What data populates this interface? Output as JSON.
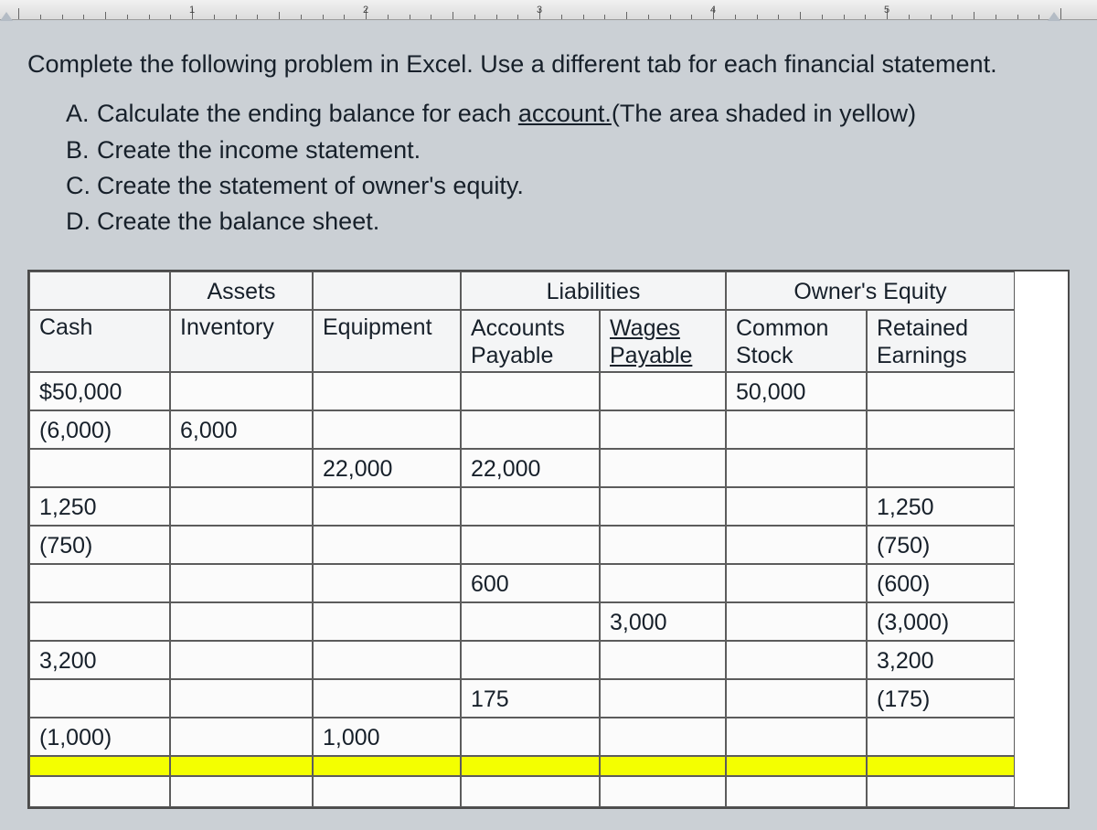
{
  "ruler_numbers": [
    "1",
    "2",
    "3",
    "4",
    "5"
  ],
  "instruction": "Complete the following problem in Excel. Use a different tab for each financial statement.",
  "steps": [
    {
      "letter": "A.",
      "text_prefix": "Calculate the ending balance for each ",
      "u1": "account.",
      "text_mid": "(The area shaded in yellow)"
    },
    {
      "letter": "B.",
      "text": "Create the income statement."
    },
    {
      "letter": "C.",
      "text": "Create the statement of owner's equity."
    },
    {
      "letter": "D.",
      "text": "Create the balance sheet."
    }
  ],
  "headers": {
    "groups": {
      "assets": "Assets",
      "liabilities": "Liabilities",
      "equity": "Owner's Equity"
    },
    "cols": {
      "cash": "Cash",
      "inventory": "Inventory",
      "equipment": "Equipment",
      "accounts_payable_l1": "Accounts",
      "accounts_payable_l2": "Payable",
      "wages_payable_l1": "Wages",
      "wages_payable_l2": "Payable",
      "common_stock_l1": "Common",
      "common_stock_l2": "Stock",
      "retained_earnings_l1": "Retained",
      "retained_earnings_l2": "Earnings"
    }
  },
  "rows": [
    {
      "cash": "$50,000",
      "inventory": "",
      "equipment": "",
      "ap": "",
      "wp": "",
      "cs": "50,000",
      "re": ""
    },
    {
      "cash": "(6,000)",
      "inventory": "6,000",
      "equipment": "",
      "ap": "",
      "wp": "",
      "cs": "",
      "re": ""
    },
    {
      "cash": "",
      "inventory": "",
      "equipment": "22,000",
      "ap": "22,000",
      "wp": "",
      "cs": "",
      "re": ""
    },
    {
      "cash": "1,250",
      "inventory": "",
      "equipment": "",
      "ap": "",
      "wp": "",
      "cs": "",
      "re": "1,250"
    },
    {
      "cash": "(750)",
      "inventory": "",
      "equipment": "",
      "ap": "",
      "wp": "",
      "cs": "",
      "re": "(750)"
    },
    {
      "cash": "",
      "inventory": "",
      "equipment": "",
      "ap": "600",
      "wp": "",
      "cs": "",
      "re": "(600)"
    },
    {
      "cash": "",
      "inventory": "",
      "equipment": "",
      "ap": "",
      "wp": "3,000",
      "cs": "",
      "re": "(3,000)"
    },
    {
      "cash": "3,200",
      "inventory": "",
      "equipment": "",
      "ap": "",
      "wp": "",
      "cs": "",
      "re": "3,200"
    },
    {
      "cash": "",
      "inventory": "",
      "equipment": "",
      "ap": "175",
      "wp": "",
      "cs": "",
      "re": "(175)"
    },
    {
      "cash": "(1,000)",
      "inventory": "",
      "equipment": "1,000",
      "ap": "",
      "wp": "",
      "cs": "",
      "re": ""
    }
  ]
}
